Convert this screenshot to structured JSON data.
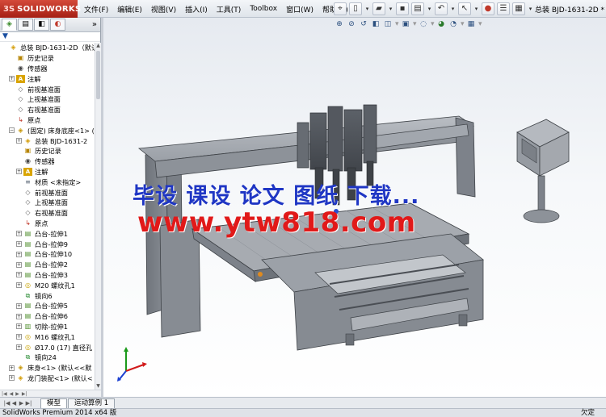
{
  "app": {
    "logo_prefix": "3S",
    "logo_text": "SOLIDWORKS",
    "doc_title": "总装 BJD-1631-2D *"
  },
  "menus": [
    "文件(F)",
    "编辑(E)",
    "视图(V)",
    "插入(I)",
    "工具(T)",
    "Toolbox",
    "窗口(W)",
    "帮助(H)"
  ],
  "panel": {
    "filter_icon": "funnel-icon",
    "collapse_glyph": "»"
  },
  "tree": [
    {
      "label": "总装 BJD-1631-2D（默认",
      "icon": "assembly-icon",
      "indent": 0,
      "expander": "",
      "glyph": "◈"
    },
    {
      "label": "历史记录",
      "icon": "history-icon",
      "indent": 1,
      "expander": "",
      "glyph": "▣"
    },
    {
      "label": "传感器",
      "icon": "sensor-icon",
      "indent": 1,
      "expander": "",
      "glyph": "◉"
    },
    {
      "label": "注解",
      "icon": "annotation-icon",
      "indent": 1,
      "expander": "+",
      "glyph": "A"
    },
    {
      "label": "前视基准面",
      "icon": "plane-icon",
      "indent": 1,
      "expander": "",
      "glyph": "◇"
    },
    {
      "label": "上视基准面",
      "icon": "plane-icon",
      "indent": 1,
      "expander": "",
      "glyph": "◇"
    },
    {
      "label": "右视基准面",
      "icon": "plane-icon",
      "indent": 1,
      "expander": "",
      "glyph": "◇"
    },
    {
      "label": "原点",
      "icon": "origin-icon",
      "indent": 1,
      "expander": "",
      "glyph": "↳"
    },
    {
      "label": "(固定) 床身底座<1> (",
      "icon": "part-icon",
      "indent": 1,
      "expander": "−",
      "glyph": "◈"
    },
    {
      "label": "总装 BJD-1631-2",
      "icon": "assembly-icon",
      "indent": 2,
      "expander": "+",
      "glyph": "◈"
    },
    {
      "label": "历史记录",
      "icon": "history-icon",
      "indent": 2,
      "expander": "",
      "glyph": "▣"
    },
    {
      "label": "传感器",
      "icon": "sensor-icon",
      "indent": 2,
      "expander": "",
      "glyph": "◉"
    },
    {
      "label": "注解",
      "icon": "annotation-icon",
      "indent": 2,
      "expander": "+",
      "glyph": "A"
    },
    {
      "label": "材质 <未指定>",
      "icon": "material-icon",
      "indent": 2,
      "expander": "",
      "glyph": "≡"
    },
    {
      "label": "前视基准面",
      "icon": "plane-icon",
      "indent": 2,
      "expander": "",
      "glyph": "◇"
    },
    {
      "label": "上视基准面",
      "icon": "plane-icon",
      "indent": 2,
      "expander": "",
      "glyph": "◇"
    },
    {
      "label": "右视基准面",
      "icon": "plane-icon",
      "indent": 2,
      "expander": "",
      "glyph": "◇"
    },
    {
      "label": "原点",
      "icon": "origin-icon",
      "indent": 2,
      "expander": "",
      "glyph": "↳"
    },
    {
      "label": "凸台-拉伸1",
      "icon": "extrude-icon",
      "indent": 2,
      "expander": "+",
      "glyph": "▤"
    },
    {
      "label": "凸台-拉伸9",
      "icon": "extrude-icon",
      "indent": 2,
      "expander": "+",
      "glyph": "▤"
    },
    {
      "label": "凸台-拉伸10",
      "icon": "extrude-icon",
      "indent": 2,
      "expander": "+",
      "glyph": "▤"
    },
    {
      "label": "凸台-拉伸2",
      "icon": "extrude-icon",
      "indent": 2,
      "expander": "+",
      "glyph": "▤"
    },
    {
      "label": "凸台-拉伸3",
      "icon": "extrude-icon",
      "indent": 2,
      "expander": "+",
      "glyph": "▤"
    },
    {
      "label": "M20 螺纹孔1",
      "icon": "hole-icon",
      "indent": 2,
      "expander": "+",
      "glyph": "◎"
    },
    {
      "label": "镜向6",
      "icon": "mirror-icon",
      "indent": 2,
      "expander": "",
      "glyph": "⧉"
    },
    {
      "label": "凸台-拉伸5",
      "icon": "extrude-icon",
      "indent": 2,
      "expander": "+",
      "glyph": "▤"
    },
    {
      "label": "凸台-拉伸6",
      "icon": "extrude-icon",
      "indent": 2,
      "expander": "+",
      "glyph": "▤"
    },
    {
      "label": "切除-拉伸1",
      "icon": "cut-icon",
      "indent": 2,
      "expander": "+",
      "glyph": "▥"
    },
    {
      "label": "M16 螺纹孔1",
      "icon": "hole-icon",
      "indent": 2,
      "expander": "+",
      "glyph": "◎"
    },
    {
      "label": "Ø17.0 (17) 直径孔",
      "icon": "hole-icon",
      "indent": 2,
      "expander": "+",
      "glyph": "◎"
    },
    {
      "label": "镜向24",
      "icon": "mirror-icon",
      "indent": 2,
      "expander": "",
      "glyph": "⧉"
    },
    {
      "label": "床身<1> (默认<<默",
      "icon": "part-icon",
      "indent": 1,
      "expander": "+",
      "glyph": "◈"
    },
    {
      "label": "龙门装配<1> (默认<",
      "icon": "assembly-icon",
      "indent": 1,
      "expander": "+",
      "glyph": "◈"
    }
  ],
  "watermark": {
    "line1": "毕设 课设 论文 图纸 下载...",
    "line2": "www.ytw818.com"
  },
  "bottom_tabs": [
    "模型",
    "运动算例 1"
  ],
  "status": {
    "left": "SolidWorks Premium 2014 x64 版",
    "right": "欠定"
  }
}
